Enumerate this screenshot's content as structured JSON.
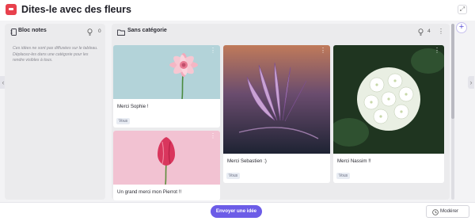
{
  "header": {
    "title": "Dites-le avec des fleurs",
    "expand_icon": "expand-icon"
  },
  "notes_column": {
    "title": "Bloc notes",
    "count": "0",
    "description": "Ces idées ne sont pas diffusées sur le tableau. Déplacez-les dans une catégorie pour les rendre visibles à tous."
  },
  "main_column": {
    "title": "Sans catégorie",
    "count": "4"
  },
  "cards": [
    {
      "caption": "Merci Sophie !",
      "tag": "Vous",
      "image": "pink-gerbera-photo"
    },
    {
      "caption": "Un grand merci mon Pierrot !!",
      "tag": "",
      "image": "pink-tulip-photo"
    },
    {
      "caption": "Merci Sebastien :)",
      "tag": "Vous",
      "image": "purple-lotus-photo"
    },
    {
      "caption": "Merci Nassim !!",
      "tag": "Vous",
      "image": "white-hydrangea-photo"
    }
  ],
  "footer": {
    "send_label": "Envoyer une idée",
    "moderate_label": "Modérer"
  },
  "colors": {
    "accent": "#6c5ce7",
    "logo": "#e8414d",
    "column_bg": "#ebebed",
    "page_bg": "#f3f3f5"
  }
}
